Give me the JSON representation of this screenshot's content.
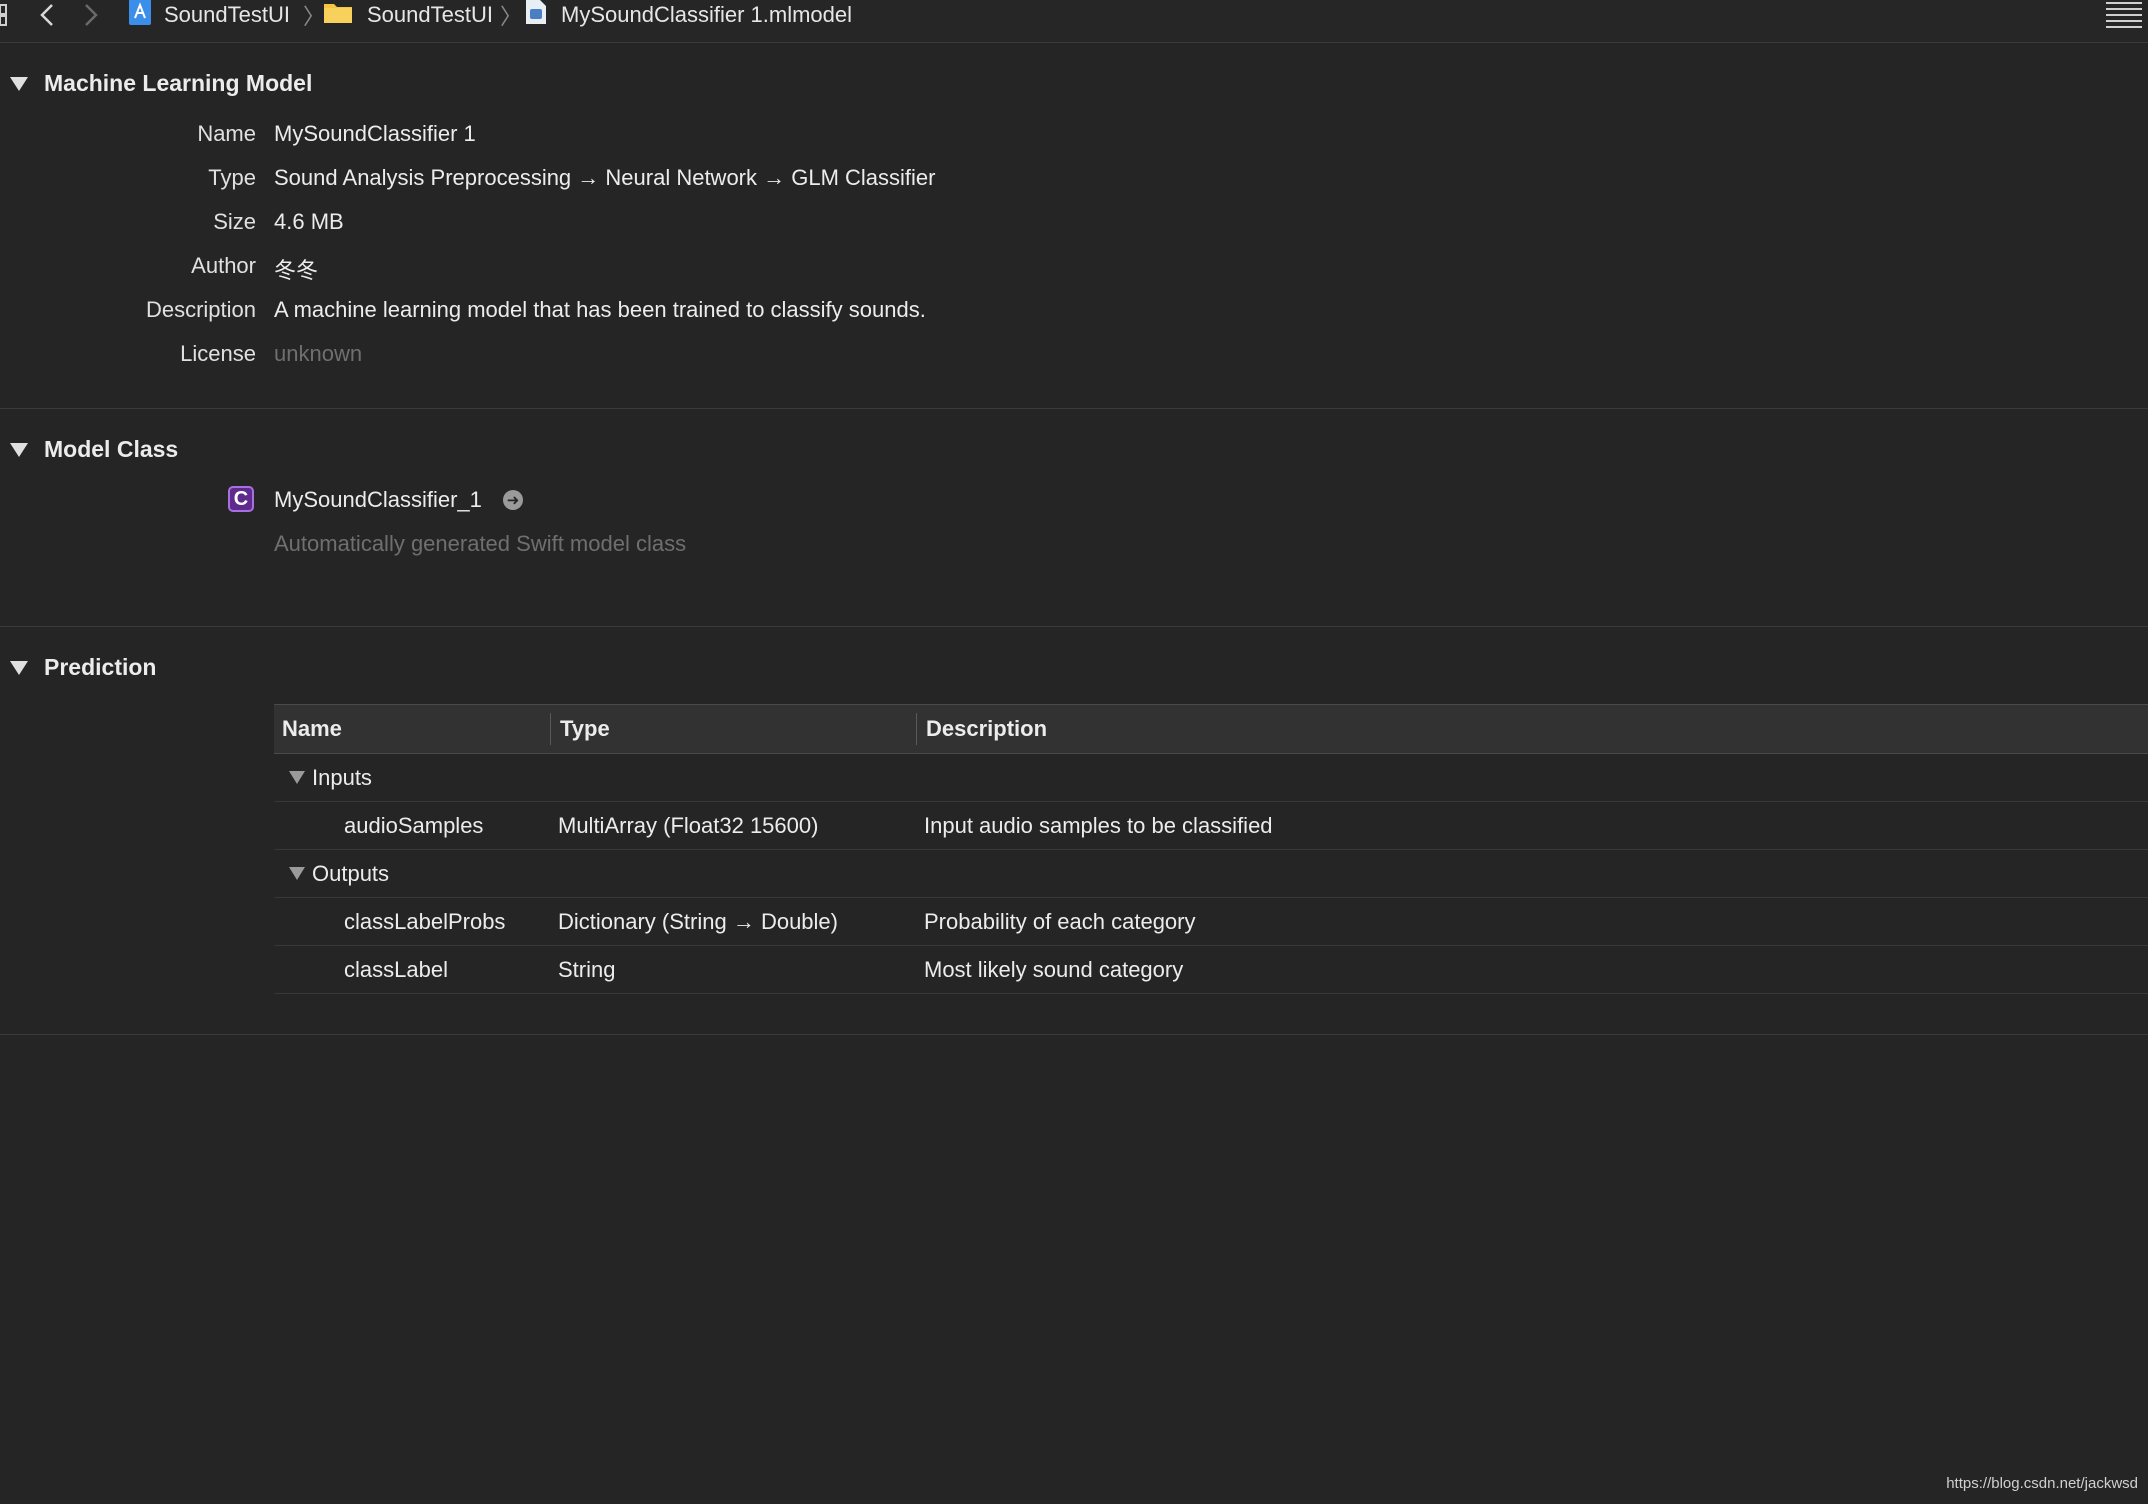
{
  "breadcrumb": {
    "project": "SoundTestUI",
    "folder": "SoundTestUI",
    "file": "MySoundClassifier 1.mlmodel"
  },
  "sections": {
    "ml_model": {
      "title": "Machine Learning Model",
      "fields": {
        "name_label": "Name",
        "name_value": "MySoundClassifier 1",
        "type_label": "Type",
        "type_value": "Sound Analysis Preprocessing → Neural Network → GLM Classifier",
        "size_label": "Size",
        "size_value": "4.6 MB",
        "author_label": "Author",
        "author_value": "冬冬",
        "description_label": "Description",
        "description_value": "A machine learning model that has been trained to classify sounds.",
        "license_label": "License",
        "license_value": "unknown"
      }
    },
    "model_class": {
      "title": "Model Class",
      "badge": "C",
      "class_name": "MySoundClassifier_1",
      "subtitle": "Automatically generated Swift model class"
    },
    "prediction": {
      "title": "Prediction",
      "headers": {
        "name": "Name",
        "type": "Type",
        "description": "Description"
      },
      "inputs_label": "Inputs",
      "outputs_label": "Outputs",
      "inputs": [
        {
          "name": "audioSamples",
          "type": "MultiArray (Float32 15600)",
          "description": "Input audio samples to be classified"
        }
      ],
      "outputs": [
        {
          "name": "classLabelProbs",
          "type": "Dictionary (String → Double)",
          "description": "Probability of each category"
        },
        {
          "name": "classLabel",
          "type": "String",
          "description": "Most likely sound category"
        }
      ]
    }
  },
  "watermark": "https://blog.csdn.net/jackwsd",
  "icons": {
    "back": "chevron-left-icon",
    "forward": "chevron-right-icon",
    "project": "xcode-project-icon",
    "folder": "folder-icon",
    "file": "mlmodel-file-icon",
    "menu": "lines-icon",
    "goto": "arrow-circle-right-icon"
  },
  "colors": {
    "background": "#252525",
    "class_badge": "#5e2b8c",
    "folder": "#f5c542",
    "project_icon": "#3b8eea"
  }
}
